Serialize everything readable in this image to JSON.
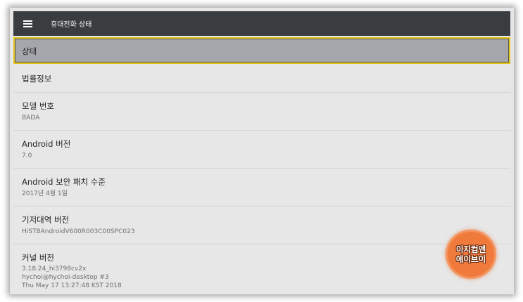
{
  "header": {
    "title": "휴대전화 상태",
    "menu_icon": "hamburger-menu-icon"
  },
  "items": [
    {
      "title": "상태",
      "subtitle": "",
      "selected": true
    },
    {
      "title": "법률정보",
      "subtitle": ""
    },
    {
      "title": "모델 번호",
      "subtitle": "BADA"
    },
    {
      "title": "Android 버전",
      "subtitle": "7.0"
    },
    {
      "title": "Android 보안 패치 수준",
      "subtitle": "2017년 4월 1일"
    },
    {
      "title": "기저대역 버전",
      "subtitle": "HiSTBAndroidV600R003C00SPC023"
    },
    {
      "title": "커널 버전",
      "subtitle_lines": [
        "3.18.24_hi3798cv2x",
        "hychoi@hychoi-desktop #3",
        "Thu May 17 13:27:48 KST 2018"
      ]
    }
  ],
  "watermark": {
    "line1": "이지컴앤",
    "line2": "에이브이"
  },
  "colors": {
    "appbar": "#3a3d3f",
    "selected_row": "#a5a6ab",
    "focus_border": "#e3c21a",
    "badge": "#f07a3c"
  }
}
